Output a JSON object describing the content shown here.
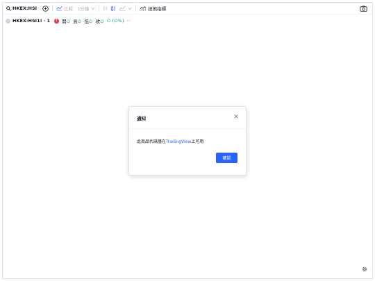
{
  "toolbar": {
    "symbol": "HKEX:HSI",
    "compare_label": "比較",
    "interval": "1分鐘",
    "indicators_label": "技術指標"
  },
  "legend": {
    "title": "HKEX:HSI1! · 1",
    "open_label": "開",
    "high_label": "高",
    "low_label": "低",
    "close_label": "收",
    "open_value": "∅",
    "high_value": "∅",
    "low_value": "∅",
    "close_value": "∅",
    "change": "∅ (∅%)",
    "more": "···"
  },
  "modal": {
    "title": "通知",
    "message_pre": "此商品代碼僅在",
    "message_link": "TradingView",
    "message_post": "上可用",
    "confirm_label": "確認"
  },
  "colors": {
    "accent": "#2962ff",
    "error": "#f23645",
    "up": "#089981"
  }
}
